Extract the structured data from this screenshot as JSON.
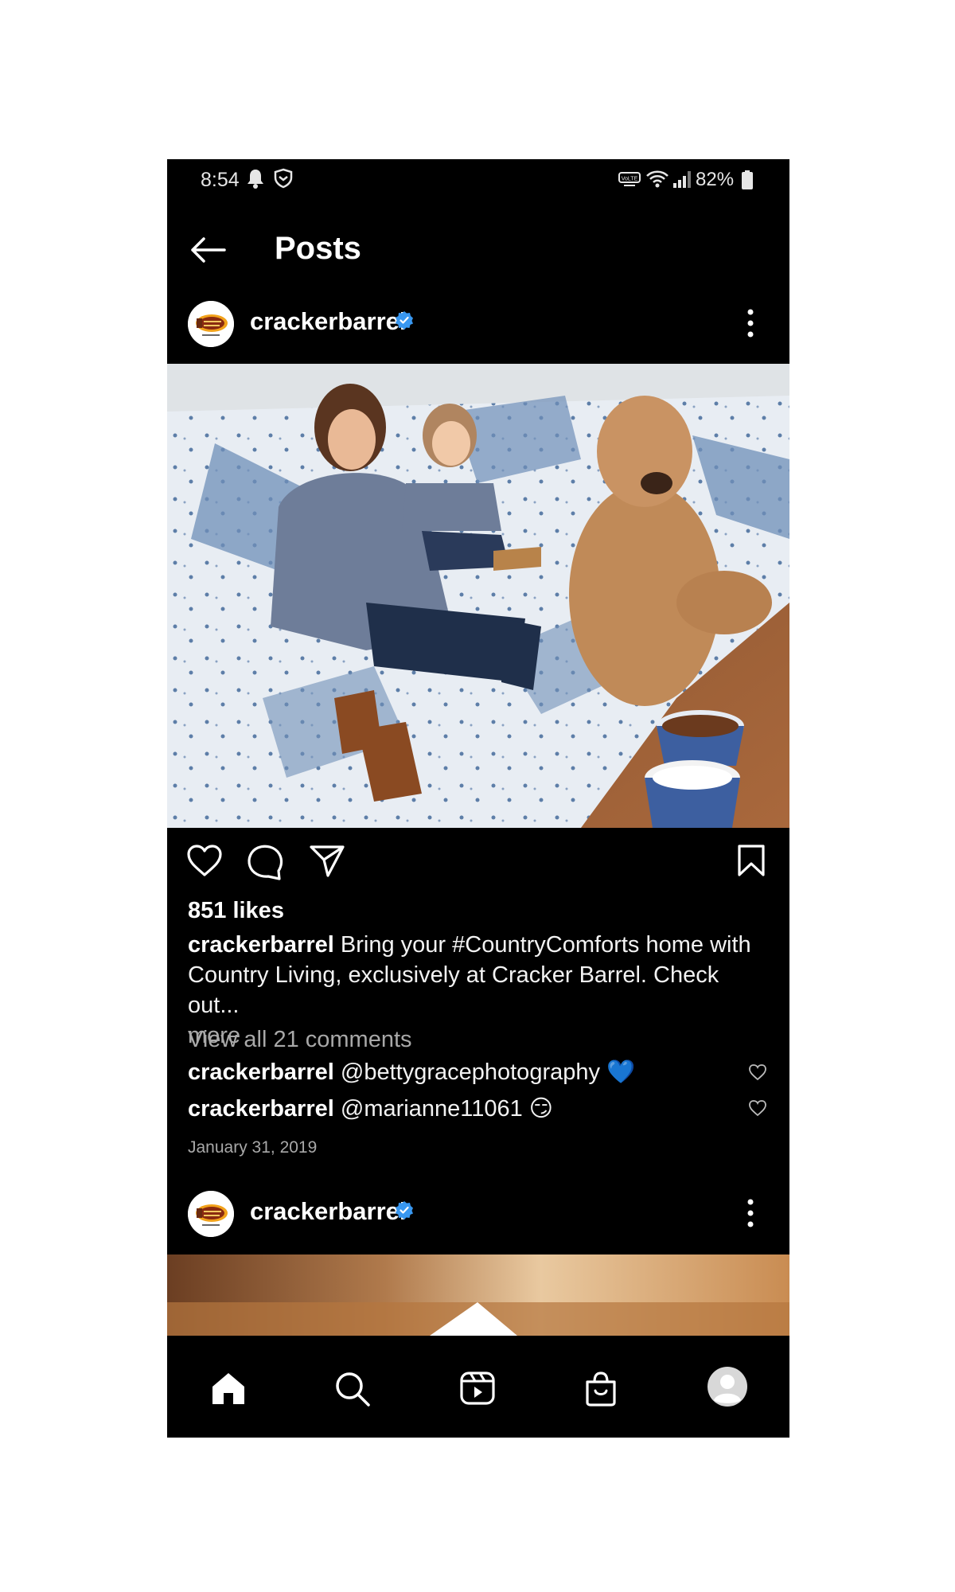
{
  "status_bar": {
    "time": "8:54",
    "battery": "82%",
    "icons": [
      "bell-icon",
      "shield-icon",
      "volte-icon",
      "wifi-icon",
      "signal-icon",
      "battery-icon"
    ]
  },
  "header": {
    "title": "Posts"
  },
  "post": {
    "username": "crackerbarrel",
    "verified": true,
    "likes": "851 likes",
    "caption_user": "crackerbarrel",
    "caption_text": "Bring your #CountryComforts home with Country Living, exclusively at Cracker Barrel. Check out...",
    "caption_more": "more",
    "view_all_comments": "View all 21 comments",
    "comments": [
      {
        "user": "crackerbarrel",
        "text": "@bettygracephotography",
        "emoji": "💙"
      },
      {
        "user": "crackerbarrel",
        "text": "@marianne11061",
        "emoji": "😏"
      }
    ],
    "date": "January 31, 2019"
  },
  "next_post": {
    "username": "crackerbarrel",
    "verified": true
  },
  "bottom_nav": [
    "home-icon",
    "search-icon",
    "reels-icon",
    "shop-icon",
    "profile-icon"
  ],
  "colors": {
    "background": "#000000",
    "verified": "#3897f0",
    "secondary_text": "#a8a8a8"
  }
}
